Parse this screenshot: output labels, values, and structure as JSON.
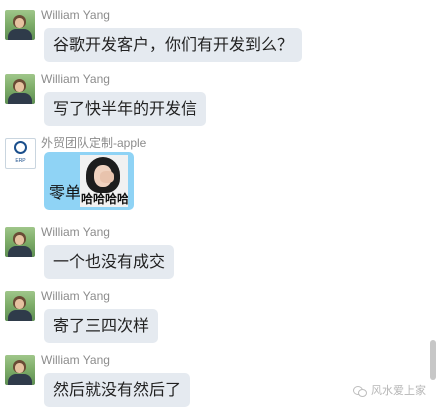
{
  "messages": [
    {
      "sender": "William Yang",
      "text": "谷歌开发客户，你们有开发到么？"
    },
    {
      "sender": "William Yang",
      "text": "写了快半年的开发信"
    },
    {
      "sender": "外贸团队定制-apple",
      "text": "零单",
      "sticker_text": "哈哈哈哈",
      "avatar_text": "ERP"
    },
    {
      "sender": "William Yang",
      "text": "一个也没有成交"
    },
    {
      "sender": "William Yang",
      "text": "寄了三四次样"
    },
    {
      "sender": "William Yang",
      "text": "然后就没有然后了"
    }
  ],
  "watermark": "风水爱上家",
  "colors": {
    "bubble": "#e5eaf0",
    "bubble_highlight": "#8fd3f5",
    "sender_text": "#8c8c8c",
    "background": "#ffffff"
  },
  "icons": {
    "avatar_william": "person-photo-avatar",
    "avatar_apple": "company-logo-avatar",
    "sticker": "laughing-girl-sticker",
    "watermark": "wechat-icon"
  }
}
